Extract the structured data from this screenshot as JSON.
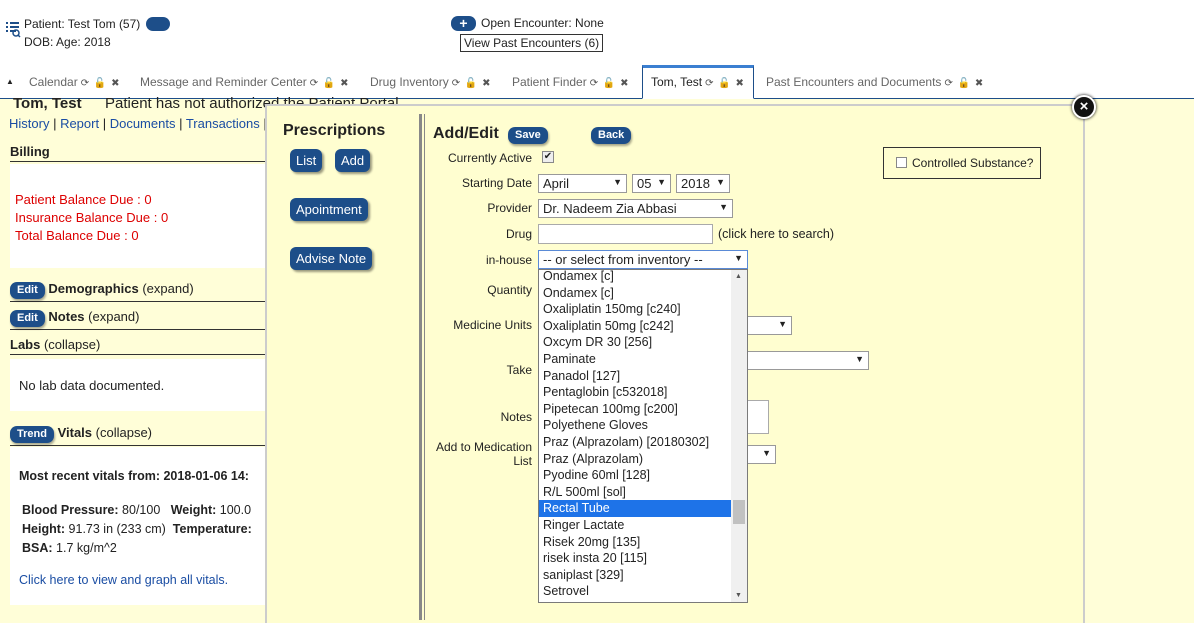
{
  "header": {
    "patient_label": "Patient: Test Tom (57)",
    "dob_label": "DOB: Age: 2018",
    "encounter_text": "Open Encounter: None",
    "past_encounters": "View Past Encounters (6)",
    "add_encounter_icon": "plus-icon"
  },
  "tabs": [
    {
      "label": "Calendar"
    },
    {
      "label": "Message and Reminder Center"
    },
    {
      "label": "Drug Inventory"
    },
    {
      "label": "Patient Finder"
    },
    {
      "label": "Tom, Test"
    },
    {
      "label": "Past Encounters and Documents"
    }
  ],
  "tab_controls": "⟳ 🔓 ✖",
  "page": {
    "patient_name": "Tom, Test",
    "portal_note": "Patient has not authorized the Patient Portal",
    "nav_links": [
      "History",
      "Report",
      "Documents",
      "Transactions"
    ],
    "billing": {
      "title": "Billing",
      "patient_balance": "Patient Balance Due : 0",
      "insurance_balance": "Insurance Balance Due : 0",
      "total_balance": "Total Balance Due : 0"
    },
    "demographics": {
      "button": "Edit",
      "title": "Demographics",
      "toggle": "(expand)"
    },
    "notes": {
      "button": "Edit",
      "title": "Notes",
      "toggle": "(expand)"
    },
    "labs": {
      "title": "Labs",
      "toggle": "(collapse)",
      "empty": "No lab data documented."
    },
    "vitals": {
      "button": "Trend",
      "title": "Vitals",
      "toggle": "(collapse)",
      "recent": "Most recent vitals from: 2018-01-06 14:",
      "bp_label": "Blood Pressure:",
      "bp_value": "80/100",
      "weight_label": "Weight:",
      "weight_value": "100.0",
      "height_label": "Height:",
      "height_value": "91.73 in (233 cm)",
      "temp_label": "Temperature:",
      "bsa_label": "BSA:",
      "bsa_value": "1.7 kg/m^2",
      "graph_link": "Click here to view and graph all vitals."
    }
  },
  "modal": {
    "title": "Prescriptions",
    "list_btn": "List",
    "add_btn": "Add",
    "appointment_btn": "Apointment",
    "advise_btn": "Advise Note",
    "form": {
      "title": "Add/Edit",
      "save_btn": "Save",
      "back_btn": "Back",
      "currently_active_label": "Currently Active",
      "controlled_label": "Controlled Substance?",
      "starting_date_label": "Starting Date",
      "month": "April",
      "day": "05",
      "year": "2018",
      "provider_label": "Provider",
      "provider_value": "Dr. Nadeem Zia Abbasi",
      "drug_label": "Drug",
      "drug_hint": "(click here to search)",
      "inhouse_label": "in-house",
      "inhouse_value": "-- or select from inventory --",
      "quantity_label": "Quantity",
      "medicine_units_label": "Medicine Units",
      "take_label": "Take",
      "notes_label": "Notes",
      "add_med_label_1": "Add to Medication",
      "add_med_label_2": "List"
    },
    "inventory_options": [
      "Ondamex [c]",
      "Ondamex [c]",
      "Oxaliplatin 150mg [c240]",
      "Oxaliplatin 50mg [c242]",
      "Oxcym DR 30 [256]",
      "Paminate",
      "Panadol [127]",
      "Pentaglobin [c532018]",
      "Pipetecan 100mg [c200]",
      "Polyethene Gloves",
      "Praz (Alprazolam) [20180302]",
      "Praz (Alprazolam)",
      "Pyodine 60ml [128]",
      "R/L 500ml [sol]",
      "Rectal Tube",
      "Ringer Lactate",
      "Risek 20mg [135]",
      "risek insta 20 [115]",
      "saniplast [329]",
      "Setrovel"
    ],
    "highlighted_option": "Rectal Tube"
  },
  "colors": {
    "accent": "#1d4e89",
    "highlight": "#1e73e8",
    "page_bg": "#fffed8",
    "alert": "#dd0000"
  }
}
